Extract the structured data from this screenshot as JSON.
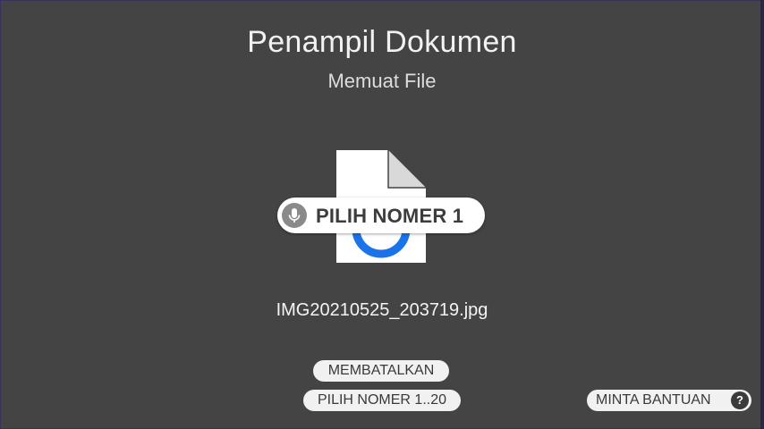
{
  "header": {
    "title": "Penampil Dokumen",
    "subtitle": "Memuat File"
  },
  "document": {
    "icon": "document-icon",
    "filename": "IMG20210525_203719.jpg"
  },
  "voice_hint": {
    "icon": "microphone-icon",
    "label": "PILIH NOMER 1"
  },
  "actions": {
    "cancel_label": "MEMBATALKAN",
    "range_label": "PILIH NOMER 1..20",
    "help_label": "MINTA BANTUAN",
    "help_icon": "?"
  },
  "colors": {
    "background": "#444444",
    "pill": "#ffffff",
    "accent": "#1a73e8"
  }
}
